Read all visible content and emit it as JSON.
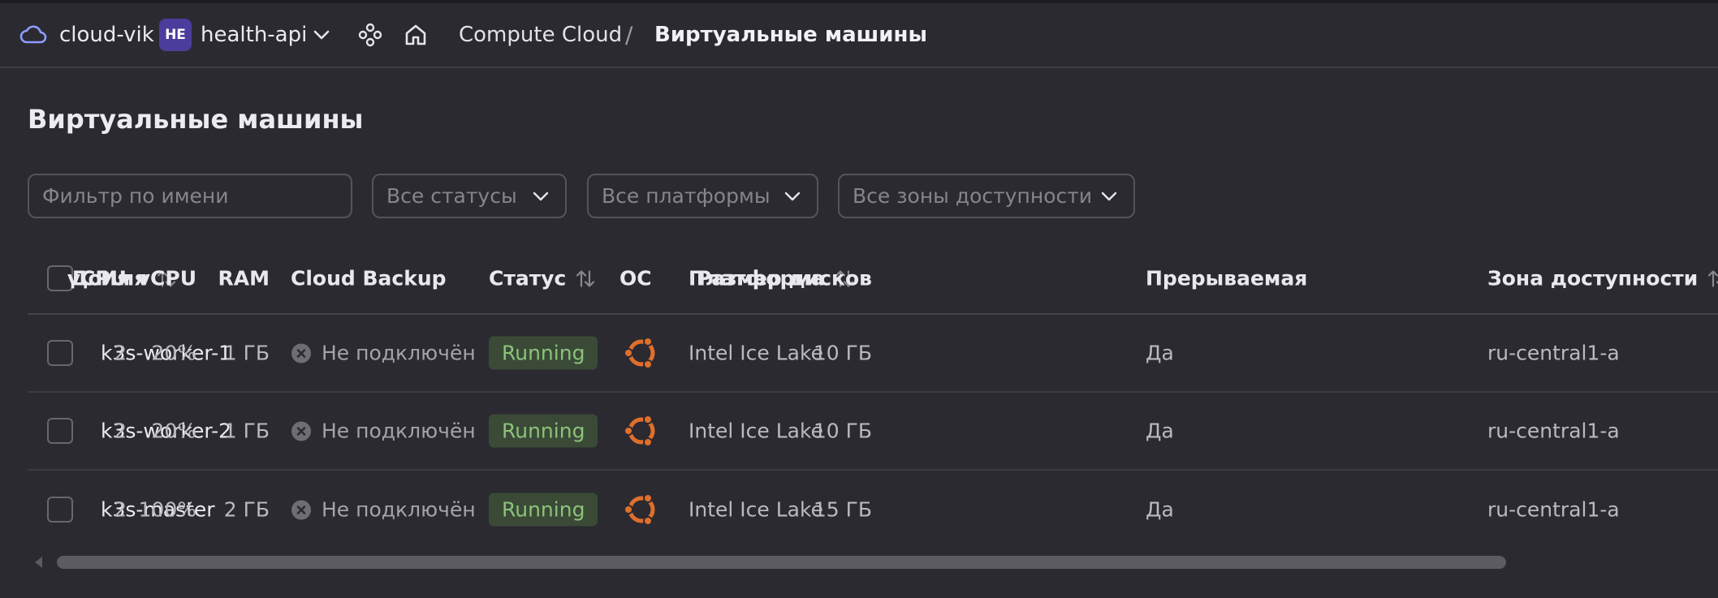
{
  "header": {
    "cloud_name": "cloud-vik",
    "folder_badge": "HE",
    "folder_name": "health-api",
    "breadcrumb": [
      "Compute Cloud",
      "/",
      "Виртуальные машины"
    ]
  },
  "page": {
    "title": "Виртуальные машины"
  },
  "filters": {
    "name_placeholder": "Фильтр по имени",
    "status_selected": "Все статусы",
    "platform_selected": "Все платформы",
    "zone_selected": "Все зоны доступности"
  },
  "table": {
    "columns": [
      "Имя",
      "Cloud Backup",
      "Статус",
      "ОС",
      "Платформа",
      "vCPU",
      "Доля vCPU",
      "RAM",
      "Прерываемая",
      "Размер дисков",
      "Зона доступности"
    ],
    "rows": [
      {
        "name": "k3s-worker-1",
        "backup": "Не подключён",
        "status": "Running",
        "os": "ubuntu",
        "platform": "Intel Ice Lake",
        "vcpu": "2",
        "vcpu_share": "20%",
        "ram": "1 ГБ",
        "preemptible": "Да",
        "disk": "10 ГБ",
        "zone": "ru-central1-a"
      },
      {
        "name": "k3s-worker-2",
        "backup": "Не подключён",
        "status": "Running",
        "os": "ubuntu",
        "platform": "Intel Ice Lake",
        "vcpu": "2",
        "vcpu_share": "20%",
        "ram": "1 ГБ",
        "preemptible": "Да",
        "disk": "10 ГБ",
        "zone": "ru-central1-a"
      },
      {
        "name": "k3s-master",
        "backup": "Не подключён",
        "status": "Running",
        "os": "ubuntu",
        "platform": "Intel Ice Lake",
        "vcpu": "2",
        "vcpu_share": "100%",
        "ram": "2 ГБ",
        "preemptible": "Да",
        "disk": "15 ГБ",
        "zone": "ru-central1-a"
      }
    ]
  },
  "colors": {
    "background": "#2b2a30",
    "status_running_bg": "#3a4a37",
    "status_running_fg": "#8cc27a",
    "ubuntu_orange": "#e06f2c",
    "folder_badge_bg": "#4b3d9c"
  },
  "icons": [
    "cloud-icon",
    "chevron-down-icon",
    "services-icon",
    "home-icon",
    "sort-icon",
    "x-circle-icon",
    "ubuntu-icon"
  ]
}
